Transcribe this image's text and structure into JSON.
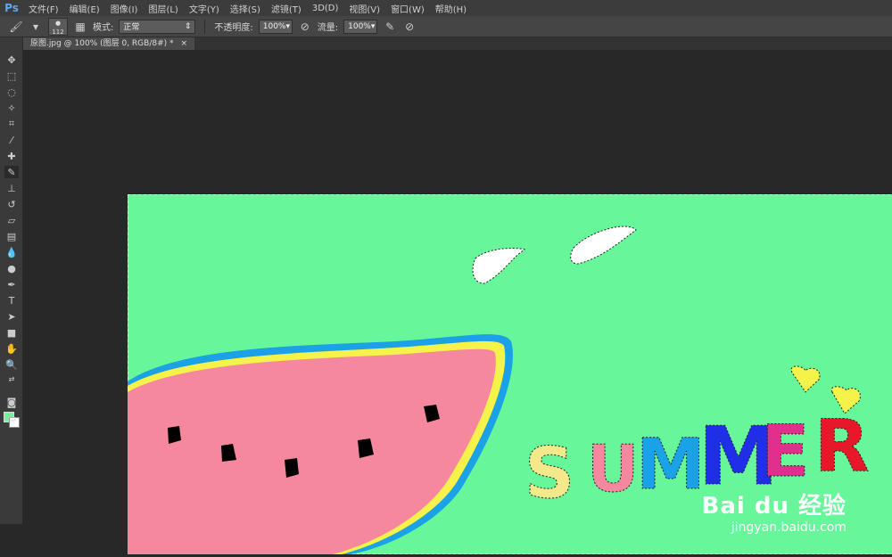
{
  "app": {
    "logo": "Ps"
  },
  "menu": [
    "文件(F)",
    "编辑(E)",
    "图像(I)",
    "图层(L)",
    "文字(Y)",
    "选择(S)",
    "滤镜(T)",
    "3D(D)",
    "视图(V)",
    "窗口(W)",
    "帮助(H)"
  ],
  "options": {
    "brush_size": "112",
    "mode_label": "模式:",
    "mode_value": "正常",
    "opacity_label": "不透明度:",
    "opacity_value": "100%",
    "flow_label": "流量:",
    "flow_value": "100%"
  },
  "document": {
    "tab_title": "原图.jpg @ 100% (图层 0, RGB/8#) *",
    "close_glyph": "×"
  },
  "canvas": {
    "background_color": "#67f79a",
    "text": "SUMMER",
    "watermark_logo": "Bai du 经验",
    "watermark_url": "jingyan.baidu.com"
  },
  "colors": {
    "foreground": "#67f79a",
    "background": "#ffffff"
  }
}
